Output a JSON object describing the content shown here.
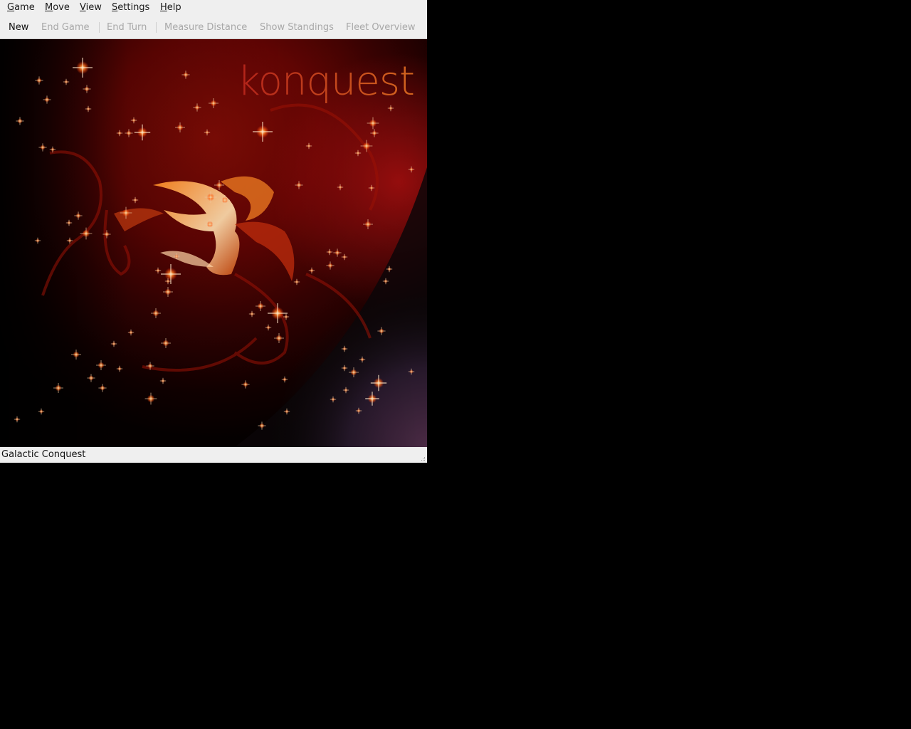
{
  "menubar": {
    "items": [
      {
        "label_underlined": "G",
        "label_rest": "ame"
      },
      {
        "label_underlined": "M",
        "label_rest": "ove"
      },
      {
        "label_underlined": "V",
        "label_rest": "iew"
      },
      {
        "label_underlined": "S",
        "label_rest": "ettings"
      },
      {
        "label_underlined": "H",
        "label_rest": "elp"
      }
    ]
  },
  "toolbar": {
    "new_label": "New",
    "end_game_label": "End Game",
    "end_turn_label": "End Turn",
    "measure_distance_label": "Measure Distance",
    "show_standings_label": "Show Standings",
    "fleet_overview_label": "Fleet Overview"
  },
  "splash": {
    "logo_text": "konquest"
  },
  "statusbar": {
    "text": "Galactic Conquest"
  }
}
